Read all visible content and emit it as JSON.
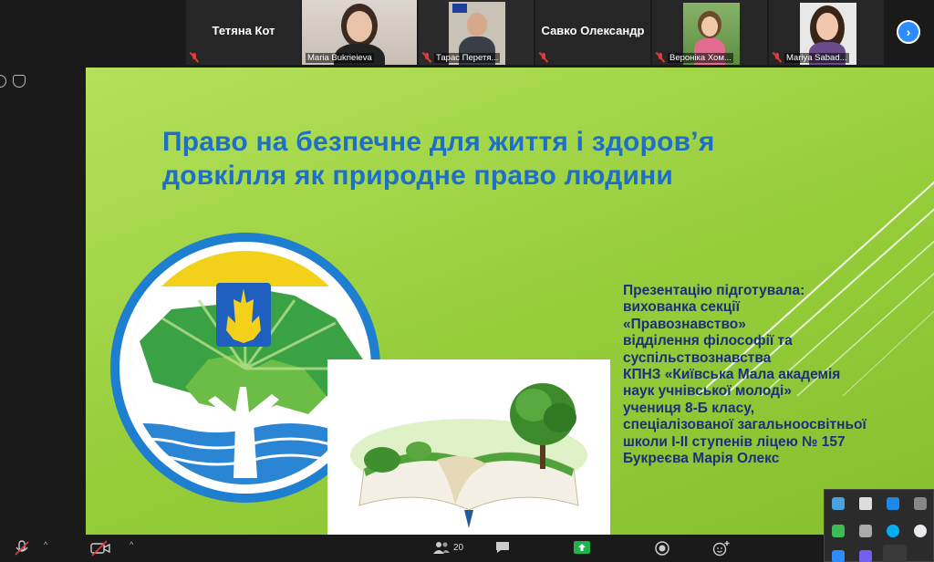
{
  "participants": [
    {
      "name": "Тетяна Кот",
      "type": "name-only"
    },
    {
      "name": "Maria Bukrieieva",
      "type": "video"
    },
    {
      "name": "Тарас Перетя...",
      "type": "video"
    },
    {
      "name": "Савко Олександр",
      "type": "name-only"
    },
    {
      "name": "Вероніка Хом...",
      "type": "video"
    },
    {
      "name": "Mariya Sabad...",
      "type": "video"
    }
  ],
  "next_icon": "chevron-right-icon",
  "slide": {
    "title_lines": [
      "Право на безпечне для життя і здоров’я",
      "довкілля як природне право людини"
    ],
    "info_lines": [
      "Презентацію підготувала:",
      "вихованка секції",
      "«Правознавство»",
      "відділення філософії та",
      "суспільствознавства",
      "КПНЗ «Київська Мала академія",
      "наук учнівської молоді»",
      "учениця 8-Б класу,",
      "спеціалізованої загальноосвітньої",
      "школи І-ІІ ступенів ліцею № 157",
      "Букреєва Марія Олекс"
    ]
  },
  "toolbar": {
    "participants_count": "20"
  },
  "colors": {
    "title_blue": "#1d6fc7",
    "info_navy": "#1b2f7a",
    "slide_green": "#95cd3a",
    "accent_blue": "#2d8cff",
    "muted_red": "#e03b3b"
  }
}
